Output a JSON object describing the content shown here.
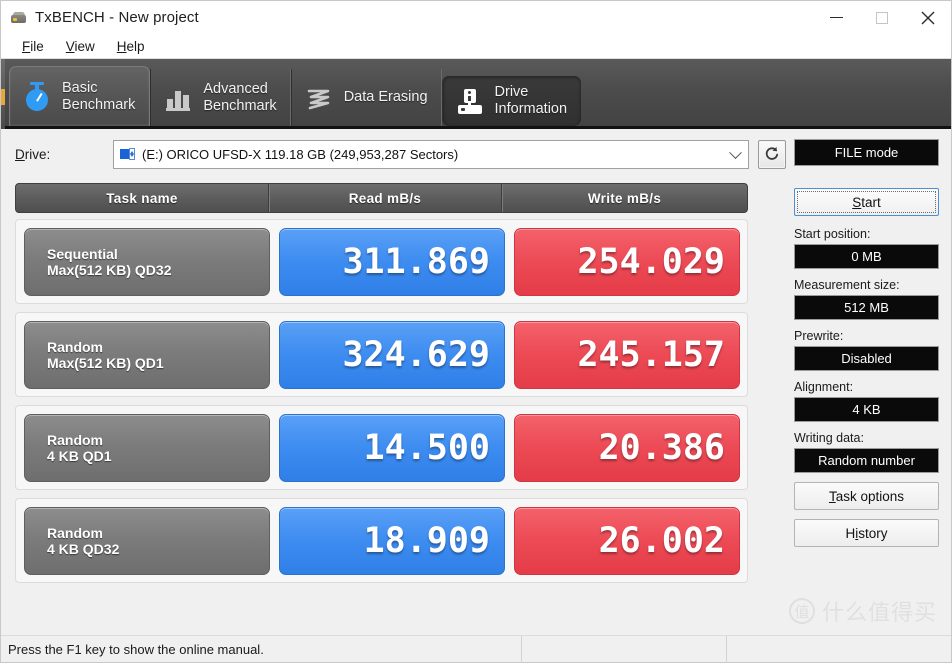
{
  "window": {
    "title": "TxBENCH - New project",
    "icon": "txbench-app-icon",
    "minimize": "minimize-icon",
    "maximize": "maximize-icon",
    "close": "close-icon"
  },
  "menu": {
    "items": [
      {
        "label": "File",
        "mnemonic": "F"
      },
      {
        "label": "View",
        "mnemonic": "V"
      },
      {
        "label": "Help",
        "mnemonic": "H"
      }
    ]
  },
  "tabs": [
    {
      "label": "Basic\nBenchmark",
      "icon": "stopwatch-icon",
      "state": "active"
    },
    {
      "label": "Advanced\nBenchmark",
      "icon": "bar-chart-icon",
      "state": "normal"
    },
    {
      "label": "Data Erasing",
      "icon": "squiggle-icon",
      "state": "normal"
    },
    {
      "label": "Drive\nInformation",
      "icon": "drive-info-icon",
      "state": "pressed"
    }
  ],
  "drive": {
    "label": "Drive:",
    "mnemonic": "D",
    "selected": "(E:) ORICO UFSD-X  119.18 GB (249,953,287 Sectors)",
    "refresh_icon": "refresh-icon",
    "dropdown_icon": "chevron-down-icon"
  },
  "table": {
    "headers": [
      "Task name",
      "Read mB/s",
      "Write mB/s"
    ],
    "rows": [
      {
        "task_line1": "Sequential",
        "task_line2": "Max(512 KB) QD32",
        "read": "311.869",
        "write": "254.029"
      },
      {
        "task_line1": "Random",
        "task_line2": "Max(512 KB) QD1",
        "read": "324.629",
        "write": "245.157"
      },
      {
        "task_line1": "Random",
        "task_line2": "4 KB QD1",
        "read": "14.500",
        "write": "20.386"
      },
      {
        "task_line1": "Random",
        "task_line2": "4 KB QD32",
        "read": "18.909",
        "write": "26.002"
      }
    ]
  },
  "panel": {
    "mode_label": "FILE mode",
    "start_label": "Start",
    "start_mnemonic": "S",
    "fields": [
      {
        "label": "Start position:",
        "value": "0 MB"
      },
      {
        "label": "Measurement size:",
        "value": "512 MB"
      },
      {
        "label": "Prewrite:",
        "value": "Disabled"
      },
      {
        "label": "Alignment:",
        "value": "4 KB"
      },
      {
        "label": "Writing data:",
        "value": "Random number"
      }
    ],
    "task_options_label": "Task options",
    "task_options_mnemonic": "T",
    "history_label": "History",
    "history_mnemonic": "i"
  },
  "statusbar": {
    "message": "Press the F1 key to show the online manual.",
    "segment2": "",
    "segment3": ""
  },
  "watermark": {
    "badge": "值",
    "text": "什么值得买"
  },
  "colors": {
    "read_blue": "#3d8cf0",
    "write_red": "#ec4a55",
    "task_gray": "#7c7c7c",
    "tabstrip": "#4c4c4c",
    "field_black": "#0a0a0a",
    "accent_orange": "#e8a93a"
  }
}
